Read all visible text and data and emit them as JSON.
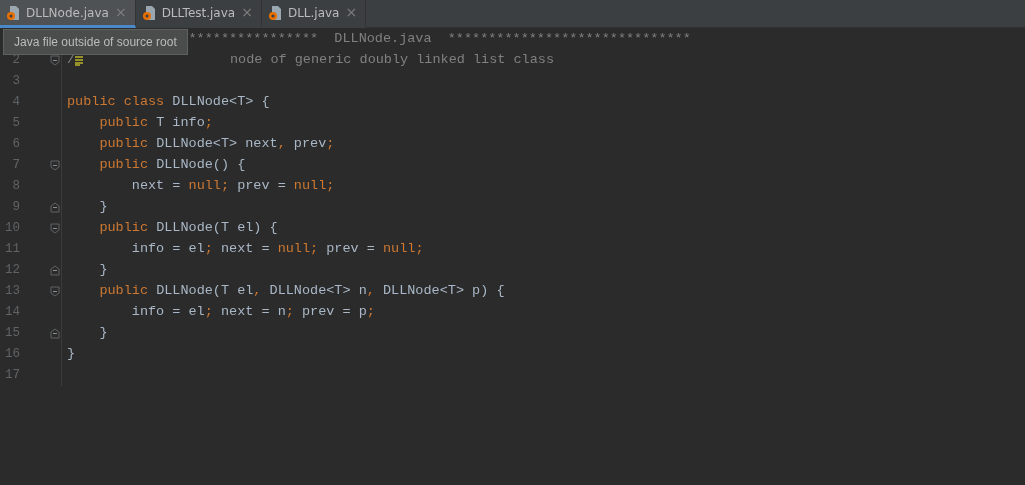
{
  "tabs": [
    {
      "label": "DLLNode.java",
      "selected": true,
      "close": "×"
    },
    {
      "label": "DLLTest.java",
      "selected": false,
      "close": "×"
    },
    {
      "label": "DLL.java",
      "selected": false,
      "close": "×"
    }
  ],
  "tooltip": "Java file outside of source root",
  "lines": [
    {
      "covered": true,
      "tokens": [
        {
          "kind": "comment",
          "text": "****************  DLLNode.java  ******************************"
        }
      ]
    },
    {
      "number": "2",
      "fold_start": true,
      "tokens": [
        {
          "kind": "comment",
          "text": "/"
        },
        {
          "kind": "doc-icon"
        },
        {
          "kind": "comment",
          "text": "                  node of generic doubly linked list class"
        }
      ]
    },
    {
      "number": "3"
    },
    {
      "number": "4",
      "tokens": [
        {
          "kind": "keyword",
          "text": "public class "
        },
        {
          "kind": "plain",
          "text": "DLLNode<T> {"
        }
      ]
    },
    {
      "number": "5",
      "tokens": [
        {
          "kind": "keyword",
          "text": "    public "
        },
        {
          "kind": "plain",
          "text": "T info"
        },
        {
          "kind": "keyword",
          "text": ";"
        }
      ]
    },
    {
      "number": "6",
      "tokens": [
        {
          "kind": "keyword",
          "text": "    public "
        },
        {
          "kind": "plain",
          "text": "DLLNode<T> next"
        },
        {
          "kind": "keyword",
          "text": ", "
        },
        {
          "kind": "plain",
          "text": "prev"
        },
        {
          "kind": "keyword",
          "text": ";"
        }
      ]
    },
    {
      "number": "7",
      "fold_start": true,
      "tokens": [
        {
          "kind": "keyword",
          "text": "    public "
        },
        {
          "kind": "plain",
          "text": "DLLNode() {"
        }
      ]
    },
    {
      "number": "8",
      "tokens": [
        {
          "kind": "plain",
          "text": "        next = "
        },
        {
          "kind": "keyword",
          "text": "null; "
        },
        {
          "kind": "plain",
          "text": "prev = "
        },
        {
          "kind": "keyword",
          "text": "null;"
        }
      ]
    },
    {
      "number": "9",
      "fold_end": true,
      "tokens": [
        {
          "kind": "plain",
          "text": "    }"
        }
      ]
    },
    {
      "number": "10",
      "fold_start": true,
      "tokens": [
        {
          "kind": "keyword",
          "text": "    public "
        },
        {
          "kind": "plain",
          "text": "DLLNode(T el) {"
        }
      ]
    },
    {
      "number": "11",
      "tokens": [
        {
          "kind": "plain",
          "text": "        info = el"
        },
        {
          "kind": "keyword",
          "text": "; "
        },
        {
          "kind": "plain",
          "text": "next = "
        },
        {
          "kind": "keyword",
          "text": "null; "
        },
        {
          "kind": "plain",
          "text": "prev = "
        },
        {
          "kind": "keyword",
          "text": "null;"
        }
      ]
    },
    {
      "number": "12",
      "fold_end": true,
      "tokens": [
        {
          "kind": "plain",
          "text": "    }"
        }
      ]
    },
    {
      "number": "13",
      "fold_start": true,
      "tokens": [
        {
          "kind": "keyword",
          "text": "    public "
        },
        {
          "kind": "plain",
          "text": "DLLNode(T el"
        },
        {
          "kind": "keyword",
          "text": ", "
        },
        {
          "kind": "plain",
          "text": "DLLNode<T> n"
        },
        {
          "kind": "keyword",
          "text": ", "
        },
        {
          "kind": "plain",
          "text": "DLLNode<T> p) {"
        }
      ]
    },
    {
      "number": "14",
      "tokens": [
        {
          "kind": "plain",
          "text": "        info = el"
        },
        {
          "kind": "keyword",
          "text": "; "
        },
        {
          "kind": "plain",
          "text": "next = n"
        },
        {
          "kind": "keyword",
          "text": "; "
        },
        {
          "kind": "plain",
          "text": "prev = p"
        },
        {
          "kind": "keyword",
          "text": ";"
        }
      ]
    },
    {
      "number": "15",
      "fold_end": true,
      "tokens": [
        {
          "kind": "plain",
          "text": "    }"
        }
      ]
    },
    {
      "number": "16",
      "tokens": [
        {
          "kind": "plain",
          "text": "}"
        }
      ]
    },
    {
      "number": "17"
    }
  ]
}
